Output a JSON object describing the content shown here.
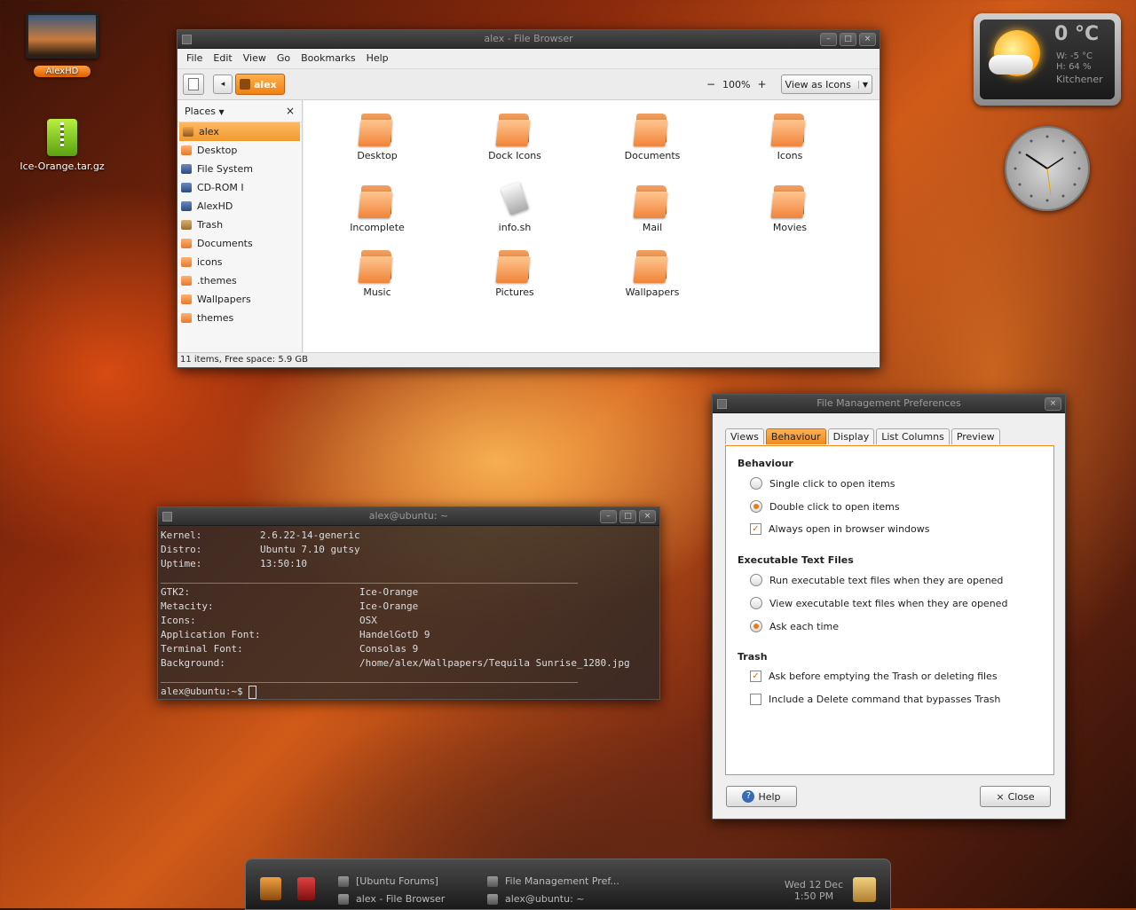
{
  "desktop": {
    "drive_label": "AlexHD",
    "archive_label": "Ice-Orange.tar.gz"
  },
  "file_browser": {
    "title": "alex - File Browser",
    "menu": [
      "File",
      "Edit",
      "View",
      "Go",
      "Bookmarks",
      "Help"
    ],
    "location": "alex",
    "zoom": "100%",
    "zoom_minus": "−",
    "zoom_plus": "+",
    "view_mode": "View as Icons",
    "places_label": "Places",
    "places": [
      {
        "label": "alex",
        "kind": "home",
        "selected": true
      },
      {
        "label": "Desktop",
        "kind": "folder"
      },
      {
        "label": "File System",
        "kind": "drive"
      },
      {
        "label": "CD-ROM I",
        "kind": "drive"
      },
      {
        "label": "AlexHD",
        "kind": "drive"
      },
      {
        "label": "Trash",
        "kind": "trash"
      },
      {
        "label": "Documents",
        "kind": "folder"
      },
      {
        "label": "icons",
        "kind": "folder"
      },
      {
        "label": ".themes",
        "kind": "folder"
      },
      {
        "label": "Wallpapers",
        "kind": "folder"
      },
      {
        "label": "themes",
        "kind": "folder"
      }
    ],
    "files": [
      {
        "label": "Desktop",
        "type": "folder"
      },
      {
        "label": "Dock Icons",
        "type": "folder"
      },
      {
        "label": "Documents",
        "type": "folder"
      },
      {
        "label": "Icons",
        "type": "folder"
      },
      {
        "label": "Incomplete",
        "type": "folder"
      },
      {
        "label": "info.sh",
        "type": "script"
      },
      {
        "label": "Mail",
        "type": "folder"
      },
      {
        "label": "Movies",
        "type": "folder"
      },
      {
        "label": "Music",
        "type": "folder"
      },
      {
        "label": "Pictures",
        "type": "folder"
      },
      {
        "label": "Wallpapers",
        "type": "folder"
      }
    ],
    "status": "11 items, Free space: 5.9 GB"
  },
  "terminal": {
    "title": "alex@ubuntu: ~",
    "system": [
      {
        "key": "Kernel:",
        "value": "2.6.22-14-generic"
      },
      {
        "key": "Distro:",
        "value": "Ubuntu 7.10 gutsy"
      },
      {
        "key": "Uptime:",
        "value": "13:50:10"
      }
    ],
    "theme": [
      {
        "key": "GTK2:",
        "value": "Ice-Orange"
      },
      {
        "key": "Metacity:",
        "value": "Ice-Orange"
      },
      {
        "key": "Icons:",
        "value": "OSX"
      },
      {
        "key": "Application Font:",
        "value": "HandelGotD 9"
      },
      {
        "key": "Terminal Font:",
        "value": "Consolas 9"
      },
      {
        "key": "Background:",
        "value": "/home/alex/Wallpapers/Tequila Sunrise_1280.jpg"
      }
    ],
    "separator": "________________________________________________________________________________",
    "prompt": "alex@ubuntu:~$ "
  },
  "prefs": {
    "title": "File Management Preferences",
    "tabs": [
      "Views",
      "Behaviour",
      "Display",
      "List Columns",
      "Preview"
    ],
    "sections": {
      "behaviour": {
        "title": "Behaviour",
        "options": [
          "Single click to open items",
          "Double click to open items",
          "Always open in browser windows"
        ]
      },
      "exec": {
        "title": "Executable Text Files",
        "options": [
          "Run executable text files when they are opened",
          "View executable text files when they are opened",
          "Ask each time"
        ]
      },
      "trash": {
        "title": "Trash",
        "options": [
          "Ask before emptying the Trash or deleting files",
          "Include a Delete command that bypasses Trash"
        ]
      }
    },
    "help_label": "Help",
    "close_label": "Close"
  },
  "weather": {
    "temp": "0 °C",
    "wind": "W: -5 °C",
    "humidity": "H: 64 %",
    "city": "Kitchener"
  },
  "taskbar": {
    "tasks": [
      "[Ubuntu Forums]",
      "alex - File Browser",
      "File Management Pref...",
      "alex@ubuntu: ~"
    ],
    "date": "Wed 12 Dec",
    "time": "1:50 PM"
  },
  "colors": {
    "accent": "#f08a20",
    "titlebar": "#3a3a3a"
  }
}
